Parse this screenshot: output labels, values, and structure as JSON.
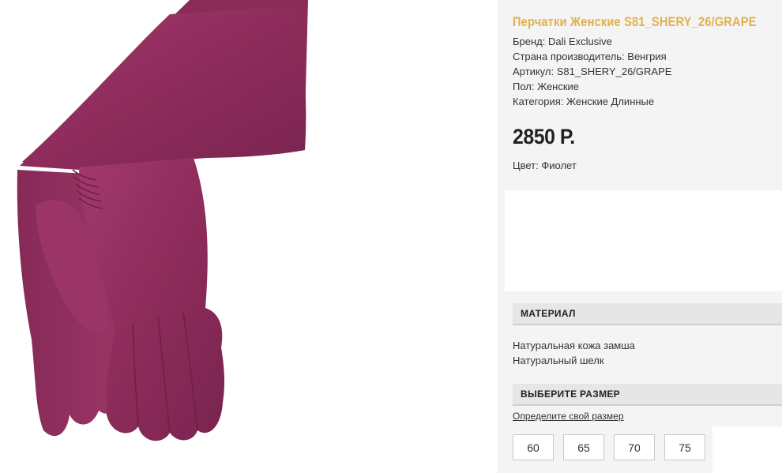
{
  "product": {
    "title": "Перчатки Женские S81_SHERY_26/GRAPE",
    "image_alt": "Перчатки Женские S81_SHERY_26/GRAPE",
    "brand": "Бренд: Dali Exclusive",
    "country": "Страна производитель: Венгрия",
    "article": "Артикул: S81_SHERY_26/GRAPE",
    "gender": "Пол: Женские",
    "category": "Категория: Женские Длинные",
    "price": "2850 Р.",
    "color": "Цвет: Фиолет"
  },
  "material": {
    "header": "МАТЕРИАЛ",
    "items": [
      "Натуральная кожа замша",
      "Натуральный шелк"
    ]
  },
  "size": {
    "header": "ВЫБЕРИТЕ РАЗМЕР",
    "link": "Определите свой размер",
    "options": [
      "60",
      "65",
      "70",
      "75"
    ]
  },
  "colors": {
    "title": "#e2b04a",
    "glove": "#93305f",
    "panel": "#f4f4f4"
  }
}
